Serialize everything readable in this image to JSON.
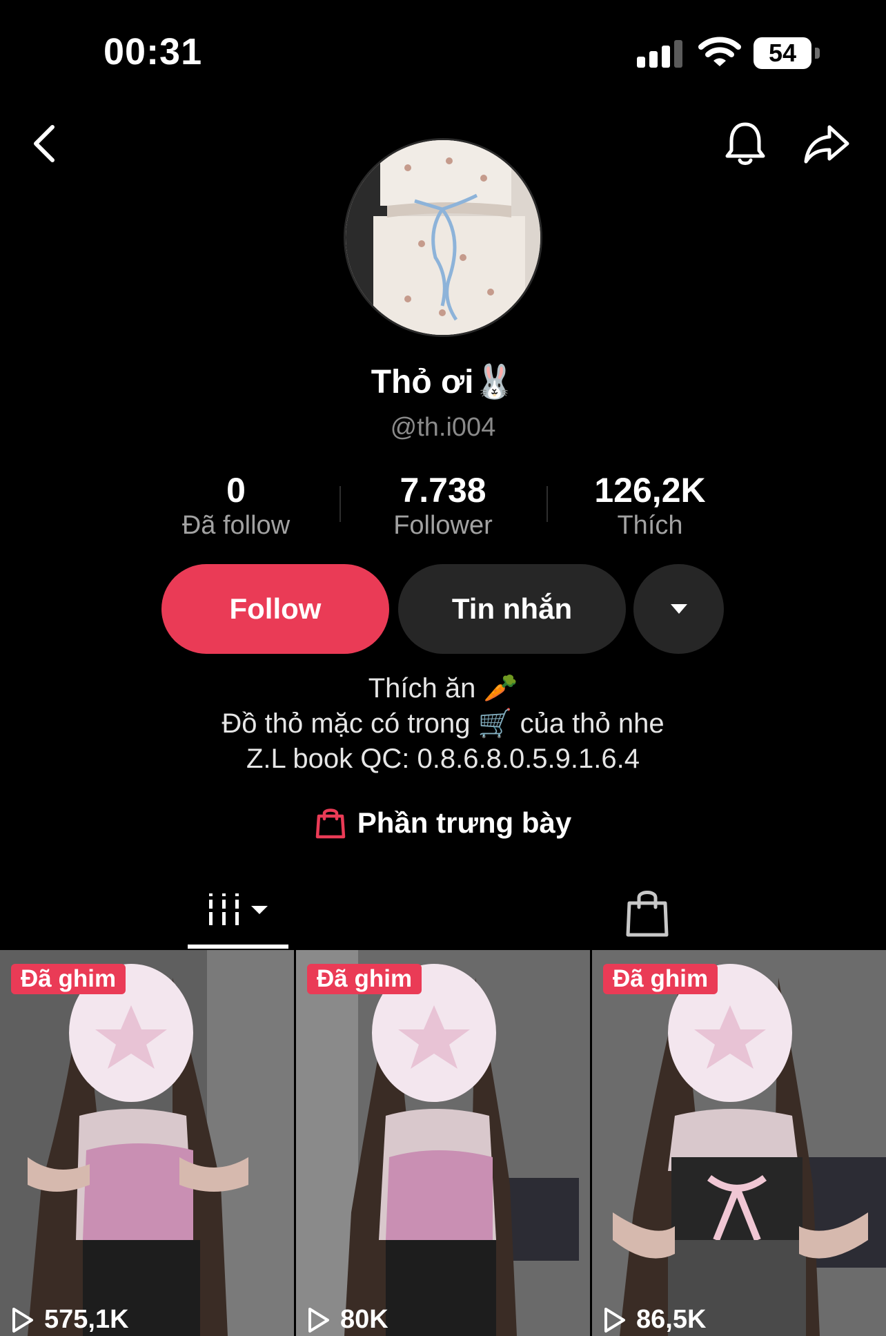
{
  "status_bar": {
    "time": "00:31",
    "battery": "54"
  },
  "header": {
    "back_icon": "chevron-left-icon",
    "bell_icon": "bell-icon",
    "share_icon": "share-arrow-icon"
  },
  "profile": {
    "display_name": "Thỏ ơi🐰",
    "username": "@th.i004",
    "stats": [
      {
        "value": "0",
        "label": "Đã follow"
      },
      {
        "value": "7.738",
        "label": "Follower"
      },
      {
        "value": "126,2K",
        "label": "Thích"
      }
    ],
    "buttons": {
      "follow": "Follow",
      "message": "Tin nhắn"
    },
    "bio": [
      "Thích ăn 🥕",
      "Đồ thỏ mặc có trong 🛒 của thỏ nhe",
      "Z.L book QC: 0.8.6.8.0.5.9.1.6.4"
    ],
    "showcase": "Phần trưng bày"
  },
  "colors": {
    "accent": "#ea3b56",
    "button_dark": "#262626",
    "background": "#000000"
  },
  "videos": [
    {
      "pinned": "Đã ghim",
      "views": "575,1K",
      "top_color": "pink"
    },
    {
      "pinned": "Đã ghim",
      "views": "80K",
      "top_color": "pink"
    },
    {
      "pinned": "Đã ghim",
      "views": "86,5K",
      "top_color": "black"
    }
  ]
}
